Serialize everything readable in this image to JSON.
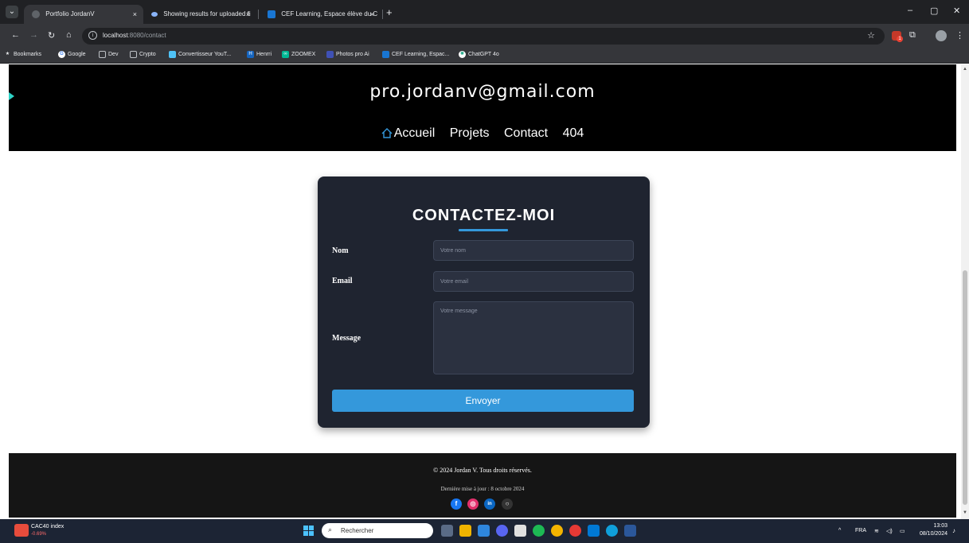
{
  "browser": {
    "tabs": [
      {
        "title": "Portfolio JordanV",
        "active": true
      },
      {
        "title": "Showing results for uploaded fi",
        "active": false
      },
      {
        "title": "CEF Learning, Espace élève du C",
        "active": false
      }
    ],
    "tab_close_glyph": "×",
    "new_tab_glyph": "+",
    "url_host": "localhost",
    "url_path": ":8080/contact",
    "bookmarks": [
      {
        "label": "Bookmarks",
        "icon": "star-icon",
        "color": "#e8eaed"
      },
      {
        "label": "Google",
        "icon": "google-icon",
        "color": "#4285f4"
      },
      {
        "label": "Dev",
        "icon": "folder-icon",
        "color": "#e8eaed"
      },
      {
        "label": "Crypto",
        "icon": "folder-icon",
        "color": "#e8eaed"
      },
      {
        "label": "Convertisseur YouT...",
        "icon": "converter-icon",
        "color": "#4fc3f7"
      },
      {
        "label": "Henrri",
        "icon": "henrri-icon",
        "color": "#1565c0"
      },
      {
        "label": "ZOOMEX",
        "icon": "zoomex-icon",
        "color": "#00b894"
      },
      {
        "label": "Photos pro Ai",
        "icon": "photos-icon",
        "color": "#3f51b5"
      },
      {
        "label": "CEF Learning, Espac...",
        "icon": "cef-icon",
        "color": "#1976d2"
      },
      {
        "label": "ChatGPT 4o",
        "icon": "chatgpt-icon",
        "color": "#10a37f"
      }
    ]
  },
  "site": {
    "email": "pro.jordanv@gmail.com",
    "nav": {
      "home": "Accueil",
      "projects": "Projets",
      "contact": "Contact",
      "notfound": "404"
    },
    "accent_color": "#3498db"
  },
  "contact": {
    "title": "CONTACTEZ-MOI",
    "name_label": "Nom",
    "name_placeholder": "Votre nom",
    "email_label": "Email",
    "email_placeholder": "Votre email",
    "message_label": "Message",
    "message_placeholder": "Votre message",
    "submit_label": "Envoyer"
  },
  "footer": {
    "copyright": "© 2024 Jordan V. Tous droits réservés.",
    "last_update": "Dernière mise à jour : 8 octobre 2024",
    "socials": [
      {
        "name": "facebook-icon",
        "glyph": "f",
        "color": "#1877f2"
      },
      {
        "name": "instagram-icon",
        "glyph": "◎",
        "color": "#e1306c"
      },
      {
        "name": "linkedin-icon",
        "glyph": "in",
        "color": "#0a66c2"
      },
      {
        "name": "github-icon",
        "glyph": "○",
        "color": "#333333"
      }
    ]
  },
  "taskbar": {
    "widget_title": "CAC40 index",
    "widget_value": "-0.69%",
    "search_placeholder": "Rechercher",
    "language": "FRA",
    "time": "13:03",
    "date": "08/10/2024"
  }
}
